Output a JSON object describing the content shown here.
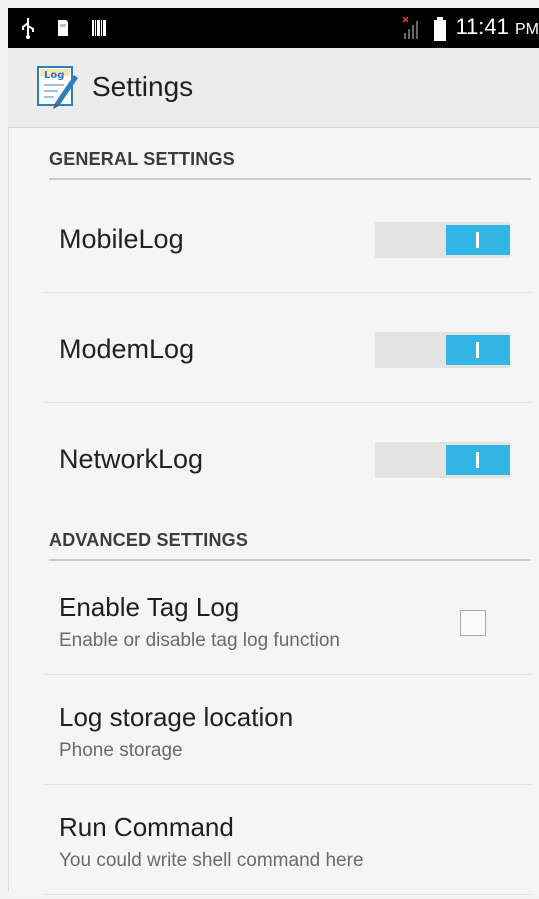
{
  "status_bar": {
    "time": "11:41",
    "ampm": "PM"
  },
  "app": {
    "title": "Settings",
    "icon_text": "Log"
  },
  "sections": {
    "general": {
      "header": "GENERAL SETTINGS",
      "items": [
        {
          "label": "MobileLog",
          "enabled": true
        },
        {
          "label": "ModemLog",
          "enabled": true
        },
        {
          "label": "NetworkLog",
          "enabled": true
        }
      ]
    },
    "advanced": {
      "header": "ADVANCED SETTINGS",
      "items": [
        {
          "title": "Enable Tag Log",
          "subtitle": "Enable or disable tag log function",
          "checked": false
        },
        {
          "title": "Log storage location",
          "subtitle": "Phone storage"
        },
        {
          "title": "Run Command",
          "subtitle": "You could write shell command here"
        }
      ]
    }
  },
  "colors": {
    "accent": "#33b5e5",
    "toggle_track": "#e3e3e3",
    "status_bar": "#000000",
    "action_bar": "#ececec"
  }
}
